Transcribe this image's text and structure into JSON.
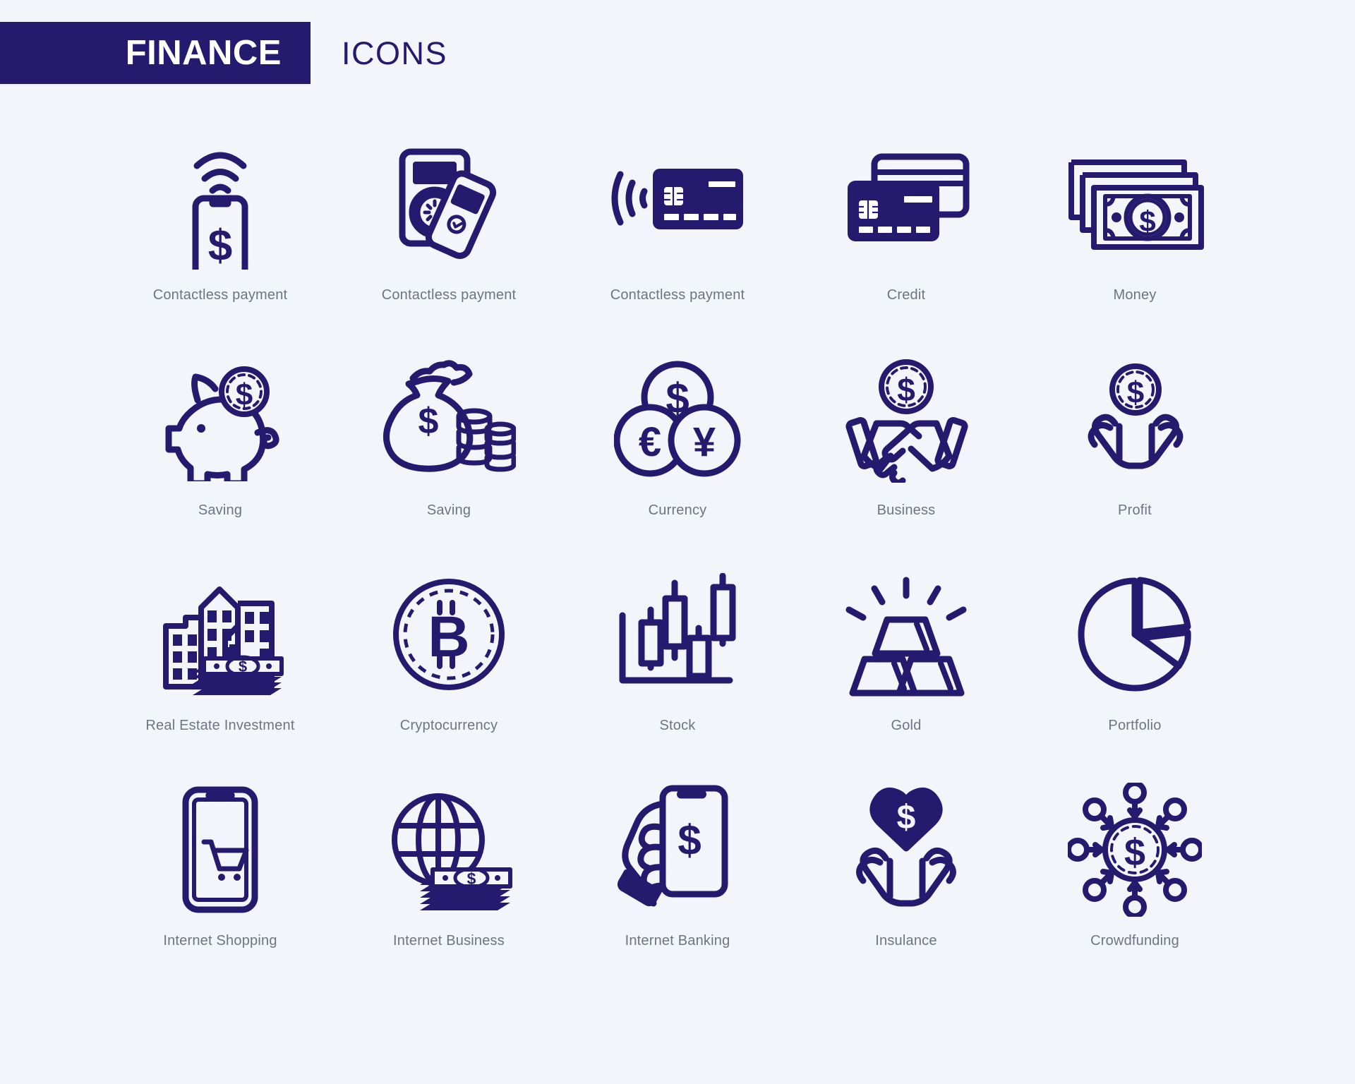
{
  "header": {
    "title": "FINANCE",
    "subtitle": "ICONS",
    "title_bg_color": "#241a6e",
    "title_text_color": "#ffffff",
    "subtitle_color": "#241a6e"
  },
  "page": {
    "background_color": "#f2f6fa",
    "icon_color": "#241a6e",
    "label_color": "#6d7580"
  },
  "icons": [
    {
      "label": "Contactless payment",
      "name": "phone-nfc-dollar-icon"
    },
    {
      "label": "Contactless payment",
      "name": "pos-terminal-phone-tap-icon"
    },
    {
      "label": "Contactless payment",
      "name": "credit-card-nfc-icon"
    },
    {
      "label": "Credit",
      "name": "credit-cards-stack-icon"
    },
    {
      "label": "Money",
      "name": "banknotes-dollar-icon"
    },
    {
      "label": "Saving",
      "name": "piggy-bank-coin-icon"
    },
    {
      "label": "Saving",
      "name": "money-bag-coins-icon"
    },
    {
      "label": "Currency",
      "name": "currency-coins-dollar-euro-yen-icon"
    },
    {
      "label": "Business",
      "name": "handshake-coin-icon"
    },
    {
      "label": "Profit",
      "name": "hands-holding-coin-icon"
    },
    {
      "label": "Real Estate Investment",
      "name": "buildings-cash-stack-icon"
    },
    {
      "label": "Cryptocurrency",
      "name": "bitcoin-coin-icon"
    },
    {
      "label": "Stock",
      "name": "candlestick-chart-icon"
    },
    {
      "label": "Gold",
      "name": "gold-bars-icon"
    },
    {
      "label": "Portfolio",
      "name": "pie-chart-icon"
    },
    {
      "label": "Internet Shopping",
      "name": "phone-shopping-cart-icon"
    },
    {
      "label": "Internet Business",
      "name": "globe-cash-stack-icon"
    },
    {
      "label": "Internet Banking",
      "name": "hand-holding-phone-dollar-icon"
    },
    {
      "label": "Insulance",
      "name": "hands-heart-dollar-icon"
    },
    {
      "label": "Crowdfunding",
      "name": "crowdfunding-network-coin-icon"
    }
  ]
}
